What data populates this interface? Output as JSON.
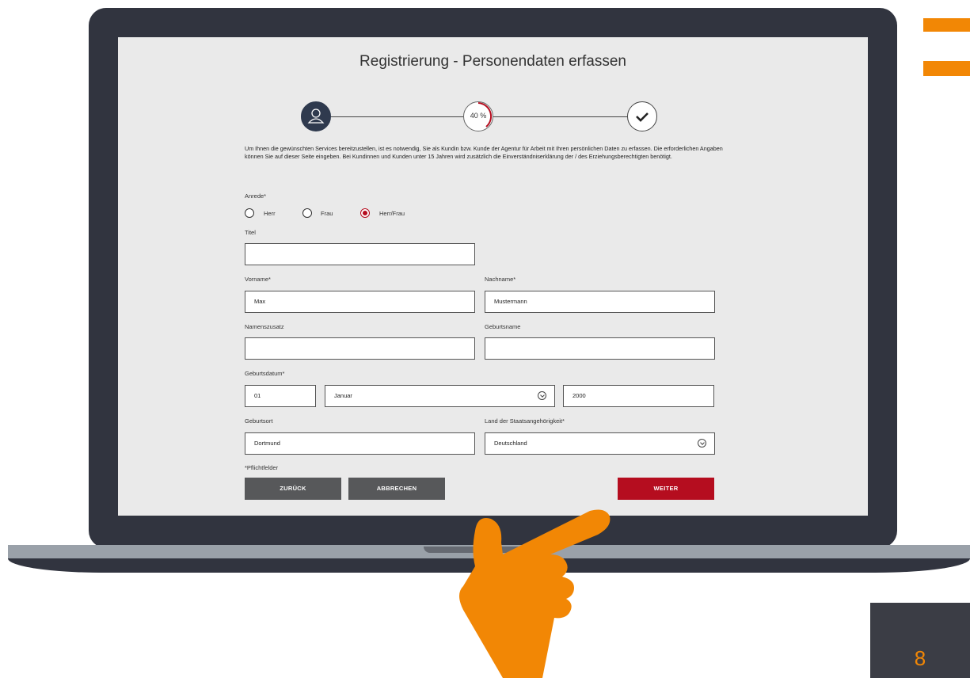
{
  "page": {
    "title": "Registrierung - Personendaten erfassen",
    "intro": "Um Ihnen die gewünschten Services bereitzustellen, ist es notwendig, Sie als Kundin bzw. Kunde der Agentur für Arbeit mit Ihren persönlichen Daten zu erfassen. Die erforderlichen Angaben können Sie auf dieser Seite eingeben. Bei Kundinnen und Kunden unter 15 Jahren wird zusätzlich die Einverständniserklärung der / des Erziehungsberechtigten benötigt.",
    "page_number": "8"
  },
  "progress": {
    "label": "40 %",
    "value": 40
  },
  "form": {
    "anrede": {
      "label": "Anrede*",
      "options": [
        "Herr",
        "Frau",
        "Herr/Frau"
      ],
      "selected": "Herr/Frau"
    },
    "titel": {
      "label": "Titel",
      "value": ""
    },
    "vorname": {
      "label": "Vorname*",
      "value": "Max"
    },
    "nachname": {
      "label": "Nachname*",
      "value": "Mustermann"
    },
    "namenszusatz": {
      "label": "Namenszusatz",
      "value": ""
    },
    "geburtsname": {
      "label": "Geburtsname",
      "value": ""
    },
    "geburtsdatum": {
      "label": "Geburtsdatum*",
      "day": "01",
      "month": "Januar",
      "year": "2000"
    },
    "geburtsort": {
      "label": "Geburtsort",
      "value": "Dortmund"
    },
    "staatsangehoerigkeit": {
      "label": "Land der Staatsangehörigkeit*",
      "value": "Deutschland"
    },
    "required_note": "*Pflichtfelder"
  },
  "buttons": {
    "back": "ZURÜCK",
    "cancel": "ABBRECHEN",
    "next": "WEITER"
  },
  "colors": {
    "accent_orange": "#f28705",
    "primary_red": "#b50d1f",
    "laptop_frame": "#31343f",
    "button_grey": "#57585a"
  },
  "icons": {
    "step1": "user-icon",
    "step3": "checkmark-icon",
    "select": "chevron-down-icon",
    "pointer": "pointing-hand-icon"
  }
}
